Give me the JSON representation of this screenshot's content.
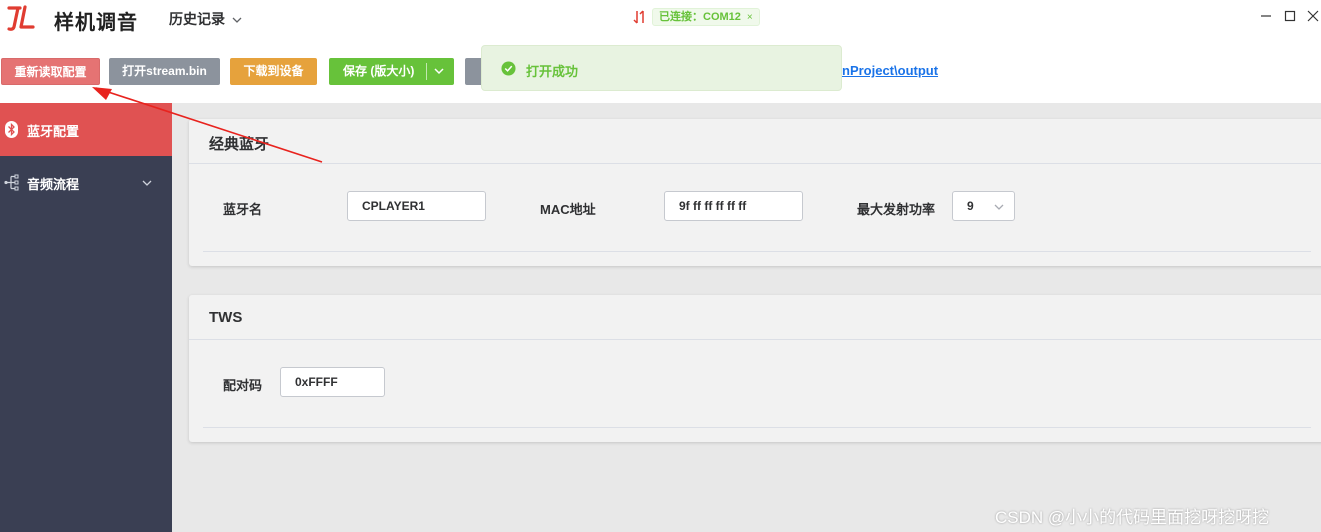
{
  "titlebar": {
    "app_title": "样机调音",
    "history_label": "历史记录",
    "connection_tag": "已连接：COM12",
    "connection_close": "×"
  },
  "toolbar": {
    "reload_label": "重新读取配置",
    "open_label": "打开stream.bin",
    "download_label": "下载到设备",
    "save_label": "保存 (版大小)",
    "path_link": "nProject\\output"
  },
  "toast": {
    "message": "打开成功"
  },
  "sidebar": {
    "items": [
      {
        "label": "蓝牙配置",
        "icon": "bluetooth-icon",
        "active": true
      },
      {
        "label": "音频流程",
        "icon": "flow-tree-icon",
        "active": false
      }
    ]
  },
  "main": {
    "classic_bt": {
      "title": "经典蓝牙",
      "name_label": "蓝牙名",
      "name_value": "CPLAYER1",
      "mac_label": "MAC地址",
      "mac_value": "9f ff ff ff ff ff",
      "power_label": "最大发射功率",
      "power_value": "9"
    },
    "tws": {
      "title": "TWS",
      "pair_label": "配对码",
      "pair_value": "0xFFFF"
    }
  },
  "watermark": "CSDN @小小的代码里面挖呀挖呀挖",
  "colors": {
    "accent_red": "#e05252",
    "success_green": "#67c23a",
    "warning_orange": "#e6a23c",
    "sidebar_bg": "#3a3f53",
    "link_blue": "#1a73e8"
  }
}
